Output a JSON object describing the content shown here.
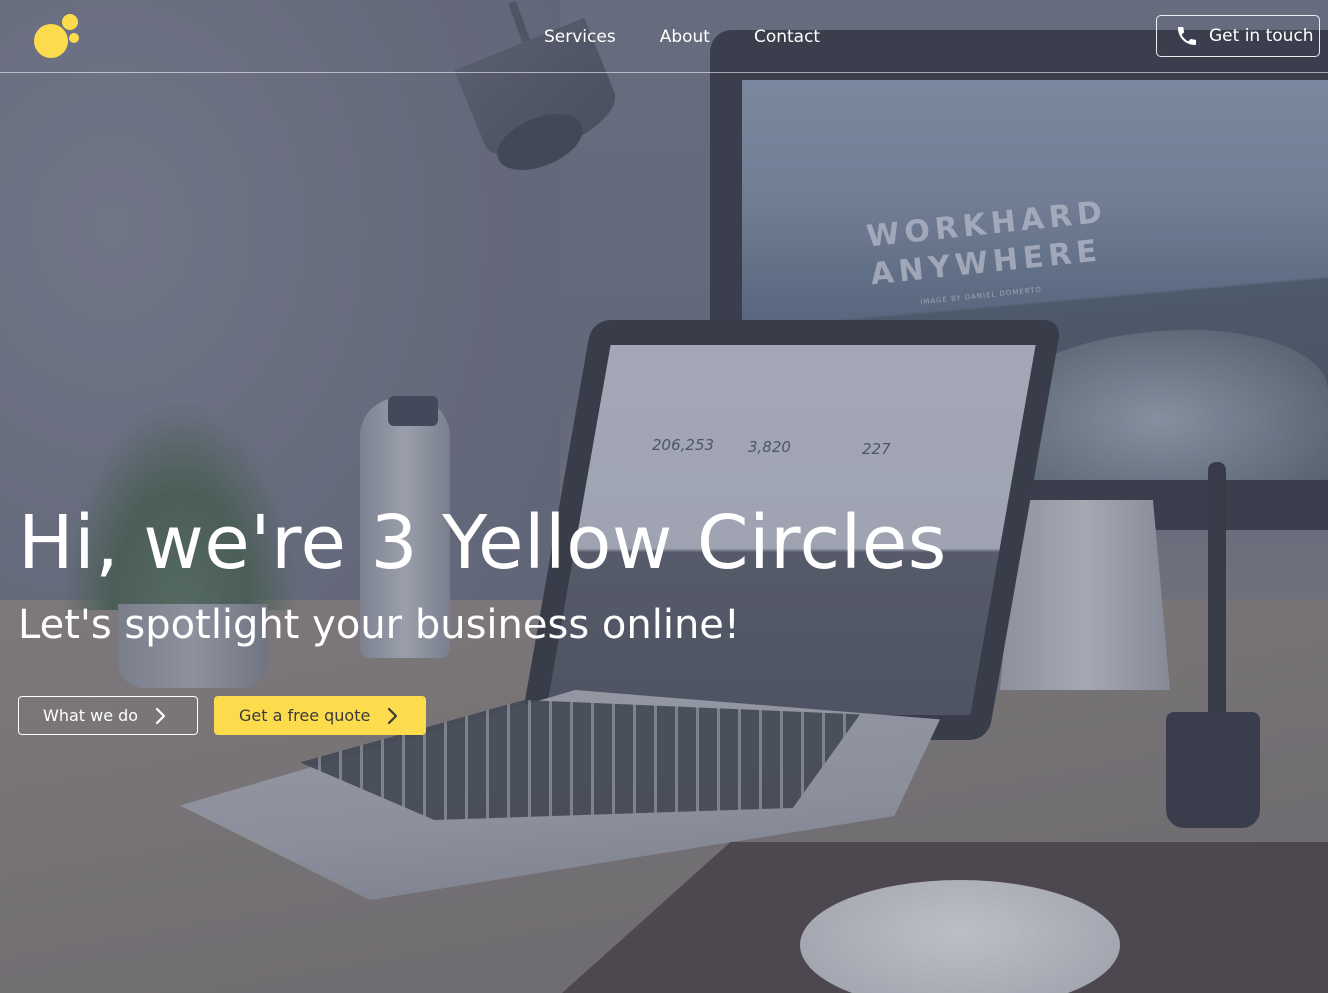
{
  "brand": {
    "logo_icon": "three-circles-logo-icon",
    "accent_color": "#fcdc4d"
  },
  "nav": {
    "items": [
      {
        "label": "Services"
      },
      {
        "label": "About"
      },
      {
        "label": "Contact"
      }
    ]
  },
  "header_cta": {
    "label": "Get in touch",
    "icon": "phone-icon"
  },
  "background": {
    "screen_wordmark_line1": "WORKHARD",
    "screen_wordmark_line2": "ANYWHERE",
    "screen_credit": "IMAGE BY DANIEL DOMERTO",
    "stats": [
      {
        "value": "206,253"
      },
      {
        "value": "3,820"
      },
      {
        "value": "227"
      }
    ]
  },
  "hero": {
    "title": "Hi, we're 3 Yellow Circles",
    "subtitle": "Let's spotlight your business online!",
    "primary_button": {
      "label": "What we do",
      "icon": "chevron-right-icon"
    },
    "secondary_button": {
      "label": "Get a free quote",
      "icon": "chevron-right-icon"
    }
  }
}
